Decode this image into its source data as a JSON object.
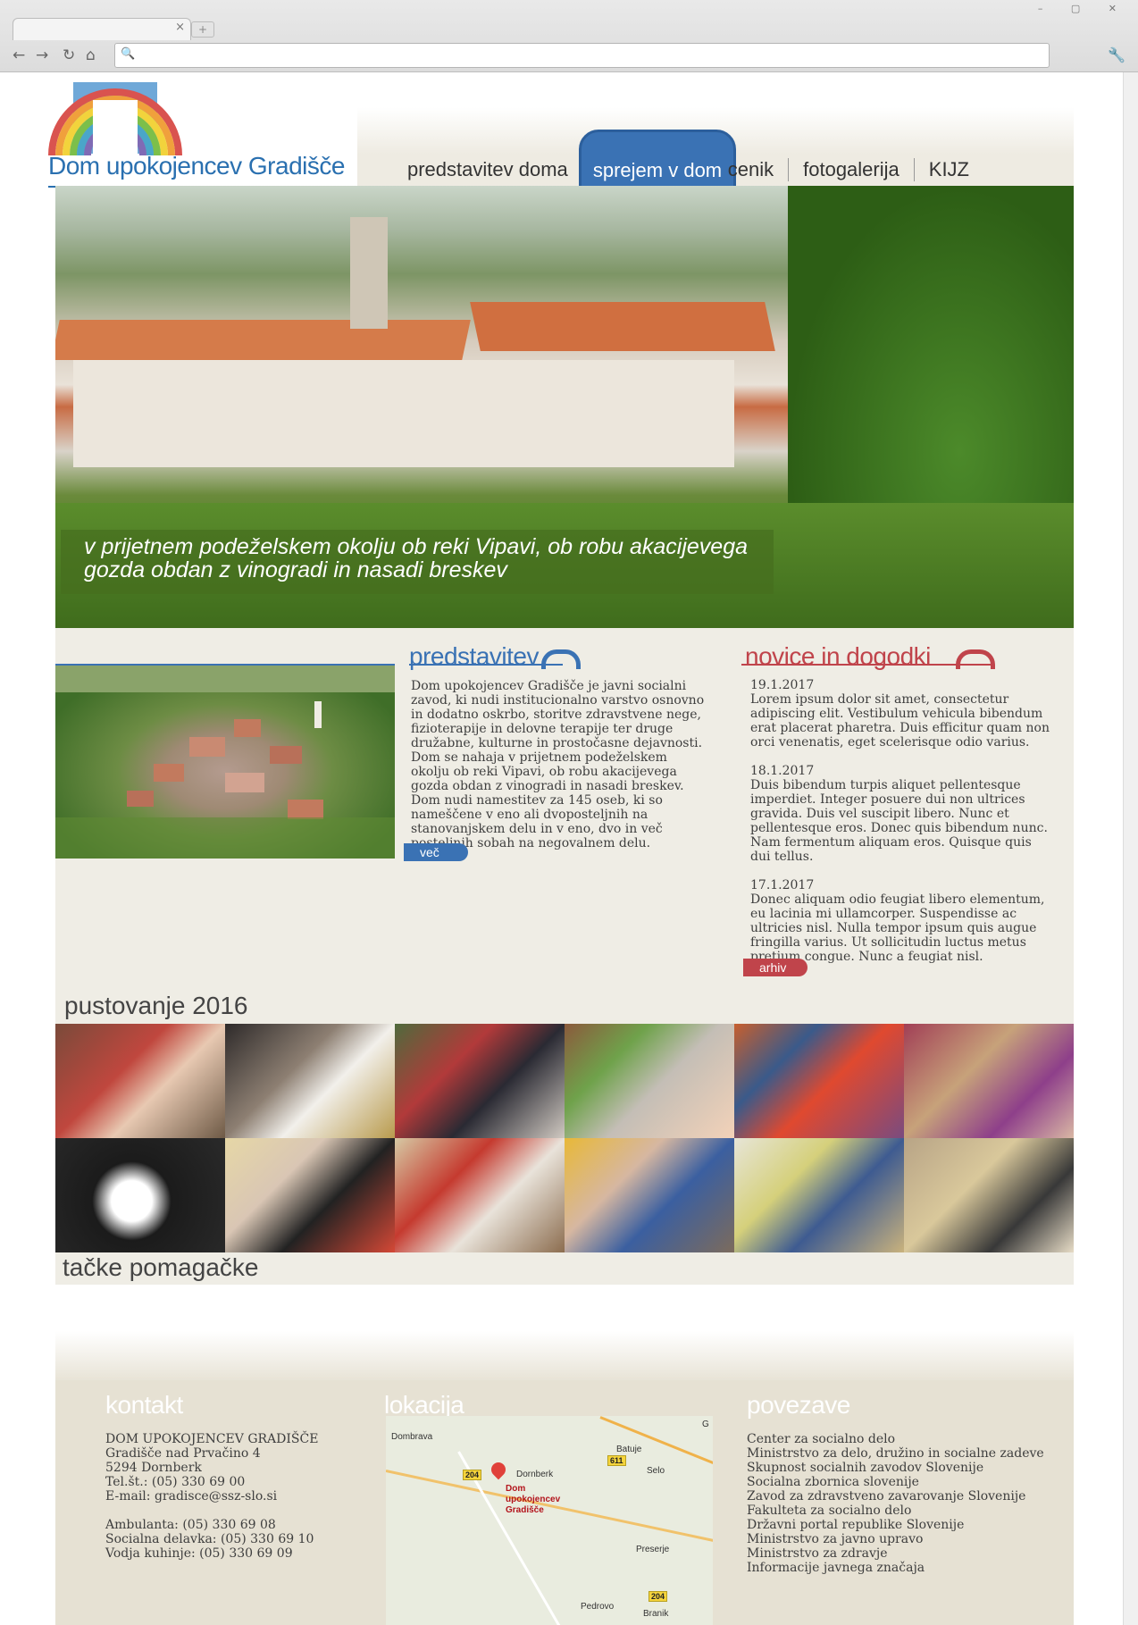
{
  "browser": {
    "tab_close": "×",
    "new_tab": "+",
    "window_buttons": "– ▢ ✕",
    "back_icon": "←",
    "forward_icon": "→",
    "reload_icon": "↻",
    "home_icon": "⌂",
    "search_icon": "🔍",
    "wrench_icon": "🔧"
  },
  "logo": {
    "text": "Dom upokojencev Gradišče"
  },
  "nav": {
    "items": [
      "predstavitev doma",
      "sprejem v dom",
      "cenik",
      "fotogalerija",
      "KIJZ"
    ],
    "active": "sprejem v dom"
  },
  "hero": {
    "caption": "v prijetnem podeželskem okolju ob reki Vipavi, ob robu akacijevega gozda obdan z vinogradi in nasadi breskev"
  },
  "predstavitev": {
    "title": "predstavitev",
    "text": "Dom upokojencev Gradišče je javni socialni zavod, ki nudi institucionalno varstvo osnovno in dodatno oskrbo, storitve zdravstvene nege, fizioterapije in delovne terapije ter druge družabne, kulturne in prostočasne dejavnosti. Dom se nahaja v prijetnem podeželskem okolju ob reki Vipavi, ob robu akacijevega gozda obdan z vinogradi in nasadi breskev. Dom nudi namestitev za 145 oseb, ki so nameščene v eno ali dvoposteljnih na stanovanjskem delu in v eno, dvo  in več posteljnih sobah na negovalnem delu.",
    "more": "več"
  },
  "news": {
    "title": "novice in dogodki",
    "items": [
      {
        "date": "19.1.2017",
        "text": "Lorem ipsum dolor sit amet, consectetur adipiscing elit. Vestibulum vehicula bibendum erat placerat pharetra. Duis efficitur quam non orci venenatis, eget scelerisque odio varius."
      },
      {
        "date": "18.1.2017",
        "text": "Duis bibendum turpis aliquet pellentesque imperdiet. Integer posuere dui non ultrices gravida. Duis vel suscipit libero. Nunc et pellentesque eros. Donec quis bibendum nunc. Nam fermentum aliquam eros. Quisque quis dui tellus."
      },
      {
        "date": "17.1.2017",
        "text": "Donec aliquam odio feugiat libero elementum, eu lacinia mi ullamcorper. Suspendisse ac ultricies nisl. Nulla tempor ipsum quis augue fringilla varius. Ut sollicitudin luctus metus pretium congue. Nunc a feugiat nisl."
      }
    ],
    "archive": "arhiv"
  },
  "gallery": {
    "title": "pustovanje 2016",
    "caption": "tačke pomagačke"
  },
  "footer": {
    "kontakt_title": "kontakt",
    "kontakt_lines": [
      "DOM UPOKOJENCEV GRADIŠČE",
      "Gradišče nad Prvačino 4",
      "5294 Dornberk",
      "Tel.št.: (05) 330 69 00",
      "E-mail: gradisce@ssz-slo.si",
      "",
      "Ambulanta: (05) 330 69 08",
      "Socialna delavka: (05) 330 69 10",
      "Vodja kuhinje: (05) 330 69 09"
    ],
    "lokacija_title": "lokacija",
    "map": {
      "labels": [
        "Dombrava",
        "Batuje",
        "Selo",
        "Dornberk",
        "Preserje",
        "Pedrovo",
        "Branik",
        "G"
      ],
      "shields": [
        "204",
        "611",
        "204"
      ],
      "place_name": "Dom upokojencev Gradišče"
    },
    "povezave_title": "povezave",
    "links": [
      "Center za socialno delo",
      "Ministrstvo za delo, družino in socialne zadeve",
      "Skupnost socialnih zavodov Slovenije",
      "Socialna zbornica slovenije",
      "Zavod za zdravstveno zavarovanje Slovenije",
      "Fakulteta za socialno delo",
      "Državni portal republike Slovenije",
      "Ministrstvo za javno upravo",
      "Ministrstvo za zdravje",
      "Informacije javnega značaja"
    ]
  },
  "colors": {
    "blue": "#3a72b4",
    "red": "#c0444b",
    "content_bg": "#efede5",
    "footer_bg": "#e6e1d3"
  }
}
